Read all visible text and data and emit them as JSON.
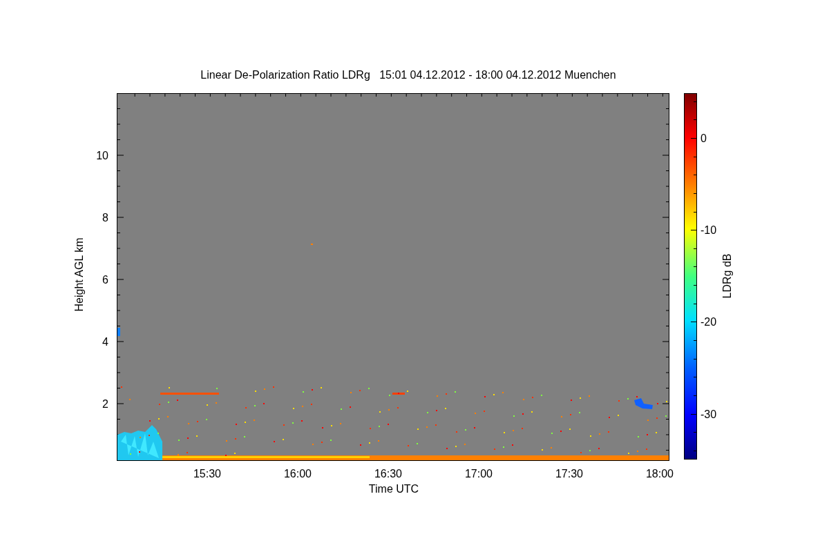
{
  "title": "Linear De-Polarization Ratio LDRg   15:01 04.12.2012 - 18:00 04.12.2012 Muenchen",
  "x_axis": {
    "label": "Time UTC",
    "ticks": [
      "15:30",
      "16:00",
      "16:30",
      "17:00",
      "17:30",
      "18:00"
    ]
  },
  "y_axis": {
    "label": "Height AGL km",
    "ticks": [
      "10",
      "8",
      "6",
      "4",
      "2"
    ]
  },
  "colorbar": {
    "label": "LDRg dB",
    "ticks": [
      "0",
      "-10",
      "-20",
      "-30"
    ]
  }
}
